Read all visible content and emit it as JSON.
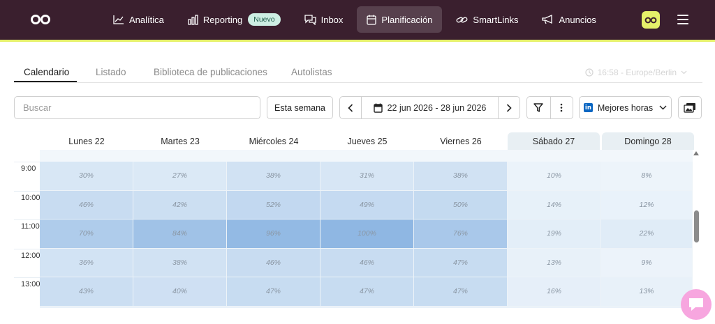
{
  "nav": {
    "items": [
      {
        "label": "Analítica",
        "icon": "chart-line-icon"
      },
      {
        "label": "Reporting",
        "icon": "bar-chart-icon",
        "badge": "Nuevo"
      },
      {
        "label": "Inbox",
        "icon": "chat-bubbles-icon"
      },
      {
        "label": "Planificación",
        "icon": "calendar-icon",
        "active": true
      },
      {
        "label": "SmartLinks",
        "icon": "link-icon"
      },
      {
        "label": "Anuncios",
        "icon": "megaphone-icon"
      }
    ]
  },
  "tabs": {
    "calendario": "Calendario",
    "listado": "Listado",
    "biblioteca": "Biblioteca de publicaciones",
    "autolistas": "Autolistas"
  },
  "timezone": "16:58 - Europe/Berlin",
  "toolbar": {
    "search_placeholder": "Buscar",
    "this_week": "Esta semana",
    "date_range": "22 jun 2026 - 28 jun 2026",
    "best_hours": "Mejores horas"
  },
  "calendar": {
    "days": [
      "Lunes 22",
      "Martes 23",
      "Miércoles 24",
      "Jueves 25",
      "Viernes 26",
      "Sábado 27",
      "Domingo 28"
    ],
    "weekend_days": [
      5,
      6
    ],
    "hours": [
      "9:00",
      "10:00",
      "11:00",
      "12:00",
      "13:00"
    ],
    "values": [
      [
        30,
        27,
        38,
        31,
        38,
        10,
        8
      ],
      [
        46,
        42,
        52,
        49,
        50,
        14,
        12
      ],
      [
        70,
        84,
        96,
        100,
        76,
        19,
        22
      ],
      [
        36,
        38,
        46,
        46,
        47,
        13,
        9
      ],
      [
        43,
        40,
        47,
        47,
        47,
        16,
        13
      ]
    ],
    "values_text": [
      [
        "30%",
        "27%",
        "38%",
        "31%",
        "38%",
        "10%",
        "8%"
      ],
      [
        "46%",
        "42%",
        "52%",
        "49%",
        "50%",
        "14%",
        "12%"
      ],
      [
        "70%",
        "84%",
        "96%",
        "100%",
        "76%",
        "19%",
        "22%"
      ],
      [
        "36%",
        "38%",
        "46%",
        "46%",
        "47%",
        "13%",
        "9%"
      ],
      [
        "43%",
        "40%",
        "47%",
        "47%",
        "47%",
        "16%",
        "13%"
      ]
    ]
  },
  "colors": {
    "topbar": "#3a1f2e",
    "accent": "#e5f06a",
    "heat_max": "#8fb7e3",
    "linkedin": "#0a66c2",
    "chat": "#f7a6df"
  }
}
